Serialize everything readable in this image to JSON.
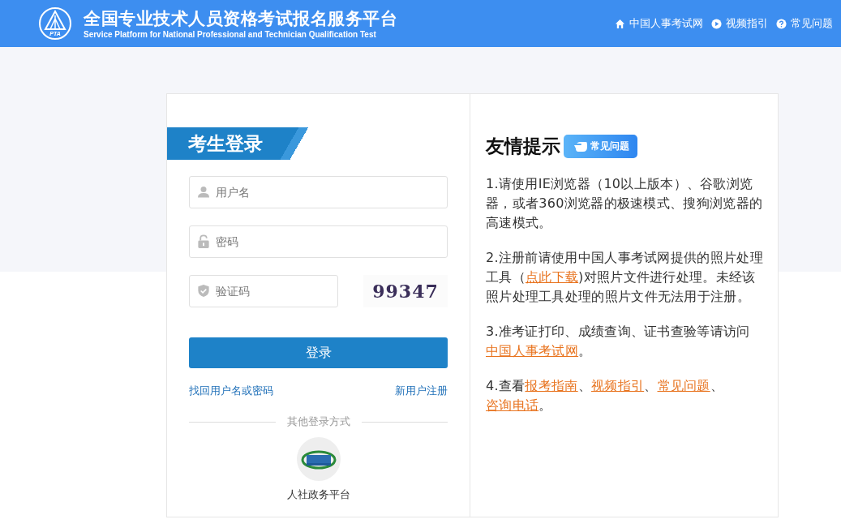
{
  "header": {
    "logo_text": "PTA",
    "title": "全国专业技术人员资格考试报名服务平台",
    "subtitle": "Service Platform for National Professional and Technician Qualification Test",
    "nav": [
      {
        "kind": "home",
        "label": "中国人事考试网"
      },
      {
        "kind": "play",
        "label": "视频指引"
      },
      {
        "kind": "help",
        "label": "常见问题"
      }
    ]
  },
  "login": {
    "title": "考生登录",
    "fields": [
      {
        "kind": "user",
        "placeholder": "用户名"
      },
      {
        "kind": "lock",
        "placeholder": "密码"
      }
    ],
    "captcha": {
      "placeholder": "验证码",
      "image_text": "99347"
    },
    "submit": "登录",
    "forgot_link": "找回用户名或密码",
    "register_link": "新用户注册",
    "other_label": "其他登录方式",
    "other_option": "人社政务平台"
  },
  "tips": {
    "title": "友情提示",
    "badge": "常见问题",
    "items": [
      [
        {
          "text": "1.请使用IE浏览器（10以上版本）、谷歌浏览器，或者360浏览器的极速模式、搜狗浏览器的高速模式。",
          "link": false
        }
      ],
      [
        {
          "text": "2.注册前请使用中国人事考试网提供的照片处理工具（",
          "link": false
        },
        {
          "text": "点此下载",
          "link": true
        },
        {
          "text": ")对照片文件进行处理。未经该照片处理工具处理的照片文件无法用于注册。",
          "link": false
        }
      ],
      [
        {
          "text": "3.准考证打印、成绩查询、证书查验等请访问",
          "link": false
        },
        {
          "text": "中国人事考试网",
          "link": true
        },
        {
          "text": "。",
          "link": false
        }
      ],
      [
        {
          "text": "4.查看",
          "link": false
        },
        {
          "text": "报考指南",
          "link": true
        },
        {
          "text": "、",
          "link": false
        },
        {
          "text": "视频指引",
          "link": true
        },
        {
          "text": "、",
          "link": false
        },
        {
          "text": "常见问题",
          "link": true
        },
        {
          "text": "、",
          "link": false
        },
        {
          "text": "咨询电话",
          "link": true
        },
        {
          "text": "。",
          "link": false
        }
      ]
    ]
  }
}
